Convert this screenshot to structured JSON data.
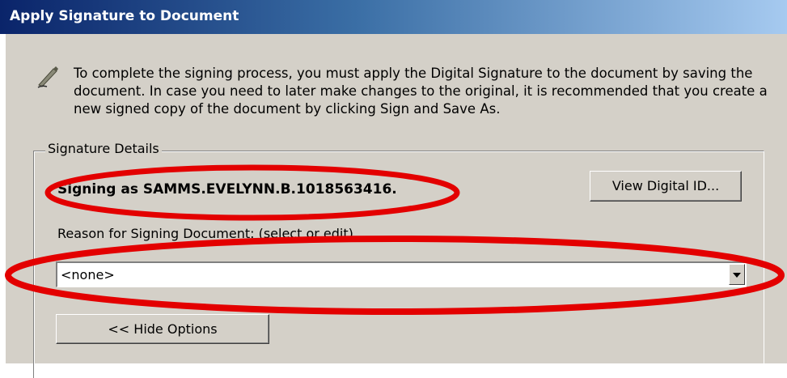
{
  "window": {
    "title": "Apply Signature to Document"
  },
  "instructions": {
    "icon": "pen-icon",
    "text": "To complete the signing process, you must apply the Digital Signature to the document by saving the document. In case you need to later make changes to the original, it is recommended that you create a new signed copy of the document by clicking Sign and Save As."
  },
  "signature_details": {
    "legend": "Signature Details",
    "signing_as": "Signing as SAMMS.EVELYNN.B.1018563416.",
    "view_digital_id_label": "View Digital ID...",
    "reason_label": "Reason for Signing Document: (select or edit)",
    "reason_value": "<none>",
    "hide_options_label": "<< Hide Options"
  },
  "colors": {
    "title_bar": "#0a246a",
    "dialog_background": "#d4d0c8",
    "annotation": "#e30000"
  }
}
